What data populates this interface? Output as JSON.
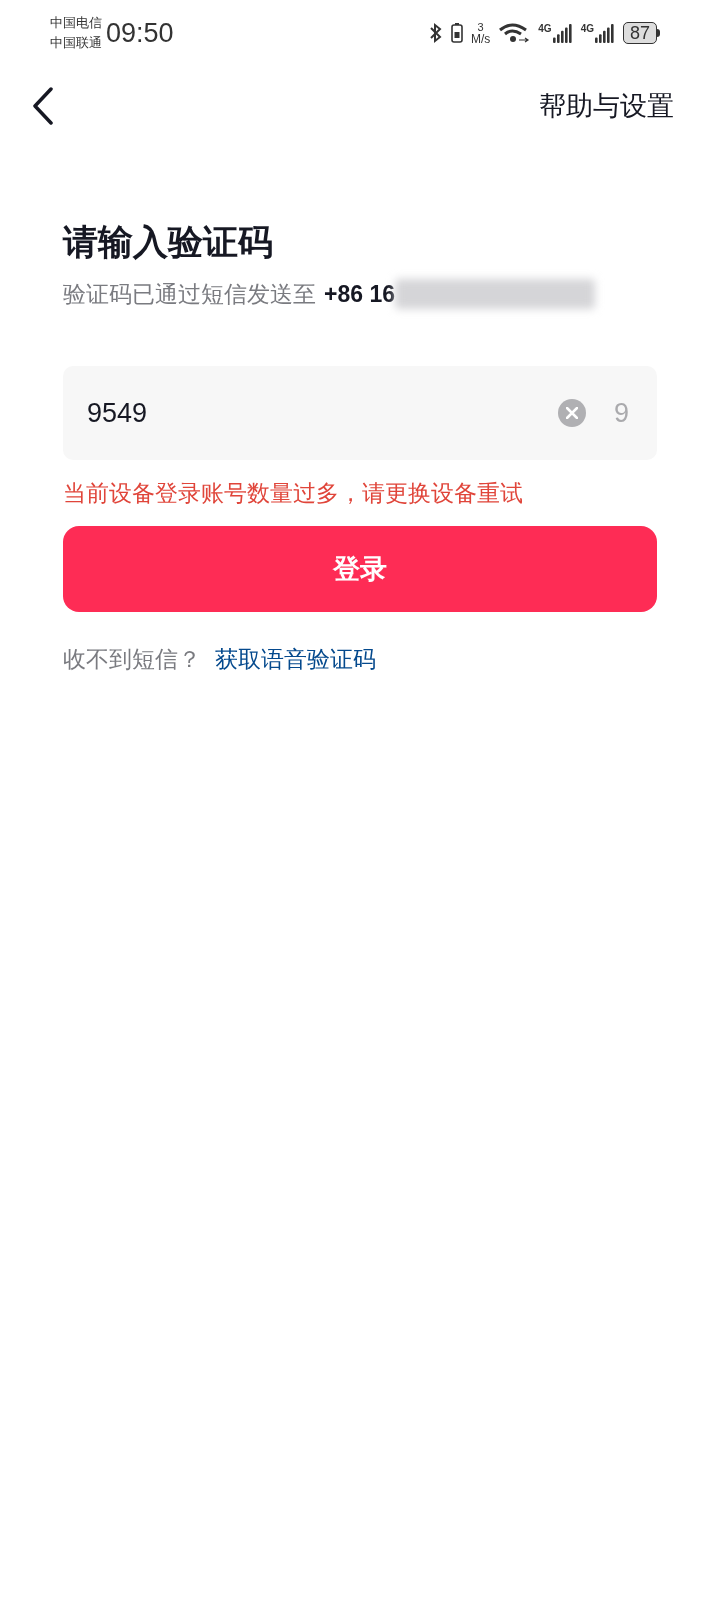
{
  "status_bar": {
    "carriers": [
      "中国电信",
      "中国联通"
    ],
    "time": "09:50",
    "speed_value": "3",
    "speed_unit": "M/s",
    "network_labels": [
      "4G",
      "4G"
    ],
    "battery": "87"
  },
  "nav": {
    "action": "帮助与设置"
  },
  "title": "请输入验证码",
  "subtitle": {
    "text": "验证码已通过短信发送至",
    "phone": "+86 16"
  },
  "code_field": {
    "value": "9549",
    "countdown": "9"
  },
  "error": "当前设备登录账号数量过多，请更换设备重试",
  "login_button": "登录",
  "footer": {
    "prompt": "收不到短信？",
    "link": "获取语音验证码"
  }
}
